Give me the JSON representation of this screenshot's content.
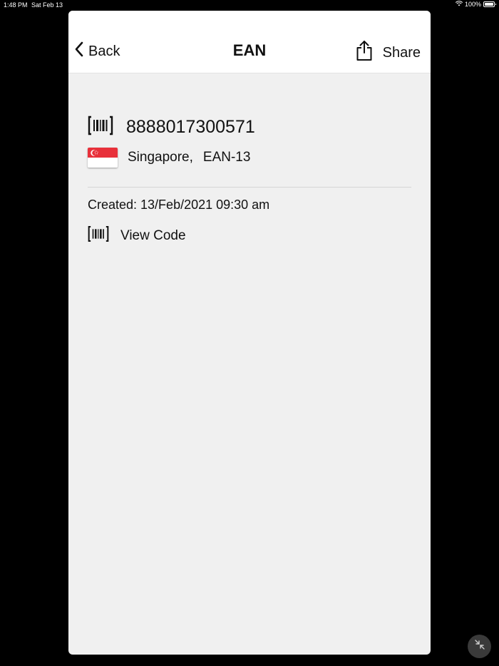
{
  "status_bar": {
    "time": "1:48 PM",
    "date": "Sat Feb 13",
    "battery": "100%"
  },
  "navbar": {
    "back_label": "Back",
    "title": "EAN",
    "share_label": "Share"
  },
  "item": {
    "code": "8888017300571",
    "country": "Singapore,",
    "code_type": "EAN-13",
    "created": "Created: 13/Feb/2021 09:30 am",
    "view_code_label": "View Code",
    "flag_colors": [
      "#e8303a",
      "#ffffff"
    ]
  },
  "icons": {
    "back": "chevron-left-icon",
    "share": "share-icon",
    "barcode": "barcode-icon",
    "flag": "singapore-flag-icon",
    "minimize": "minimize-icon"
  }
}
